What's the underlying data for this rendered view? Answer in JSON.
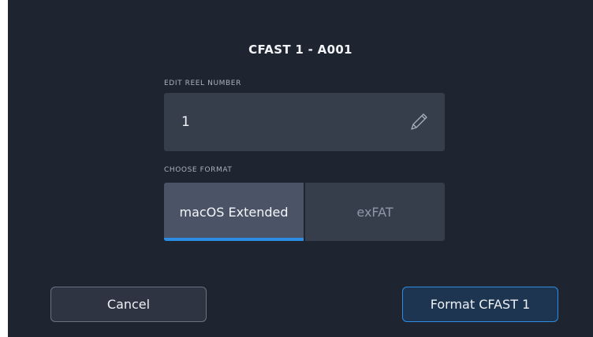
{
  "dialog": {
    "title": "CFAST 1 - A001"
  },
  "reel": {
    "label": "EDIT REEL NUMBER",
    "value": "1",
    "edit_icon": "pencil-icon"
  },
  "format": {
    "label": "CHOOSE FORMAT",
    "options": [
      {
        "label": "macOS Extended",
        "selected": true
      },
      {
        "label": "exFAT",
        "selected": false
      }
    ]
  },
  "buttons": {
    "cancel_label": "Cancel",
    "format_label": "Format CFAST 1"
  },
  "colors": {
    "background": "#1e2430",
    "field": "#363d4b",
    "selected_option": "#4b5467",
    "accent": "#2b8de3"
  }
}
